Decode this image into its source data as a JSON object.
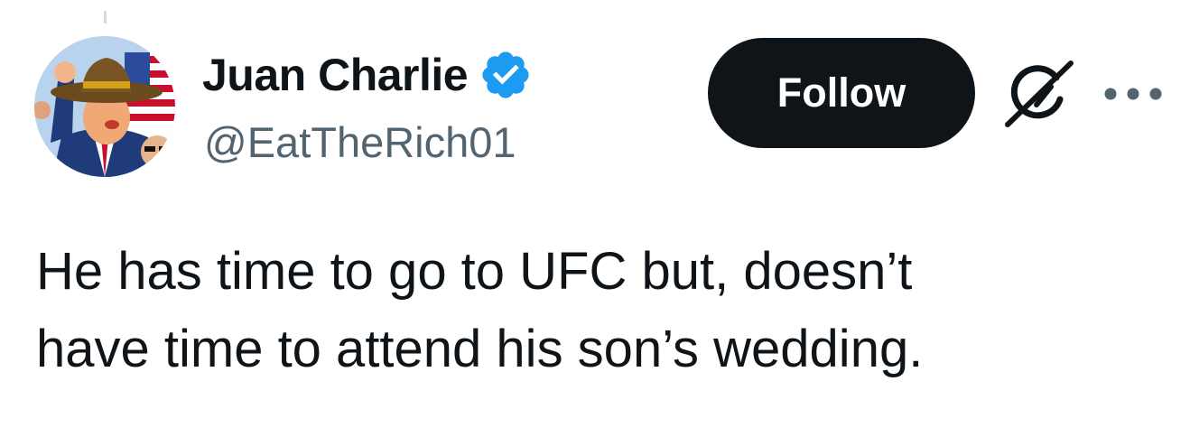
{
  "tweet": {
    "author": {
      "display_name": "Juan Charlie",
      "handle": "@EatTheRich01",
      "verified": true,
      "verified_color": "#1d9bf0",
      "avatar_icon": "avatar"
    },
    "follow_label": "Follow",
    "actions": {
      "grok_icon": "grok-icon",
      "more_icon": "more-icon"
    },
    "text_line1": "He has time to go to UFC but, doesn’t",
    "text_line2": "have time to attend his son’s wedding."
  },
  "colors": {
    "text_primary": "#0f1419",
    "text_secondary": "#536471",
    "button_bg": "#0f1419",
    "button_text": "#ffffff"
  }
}
